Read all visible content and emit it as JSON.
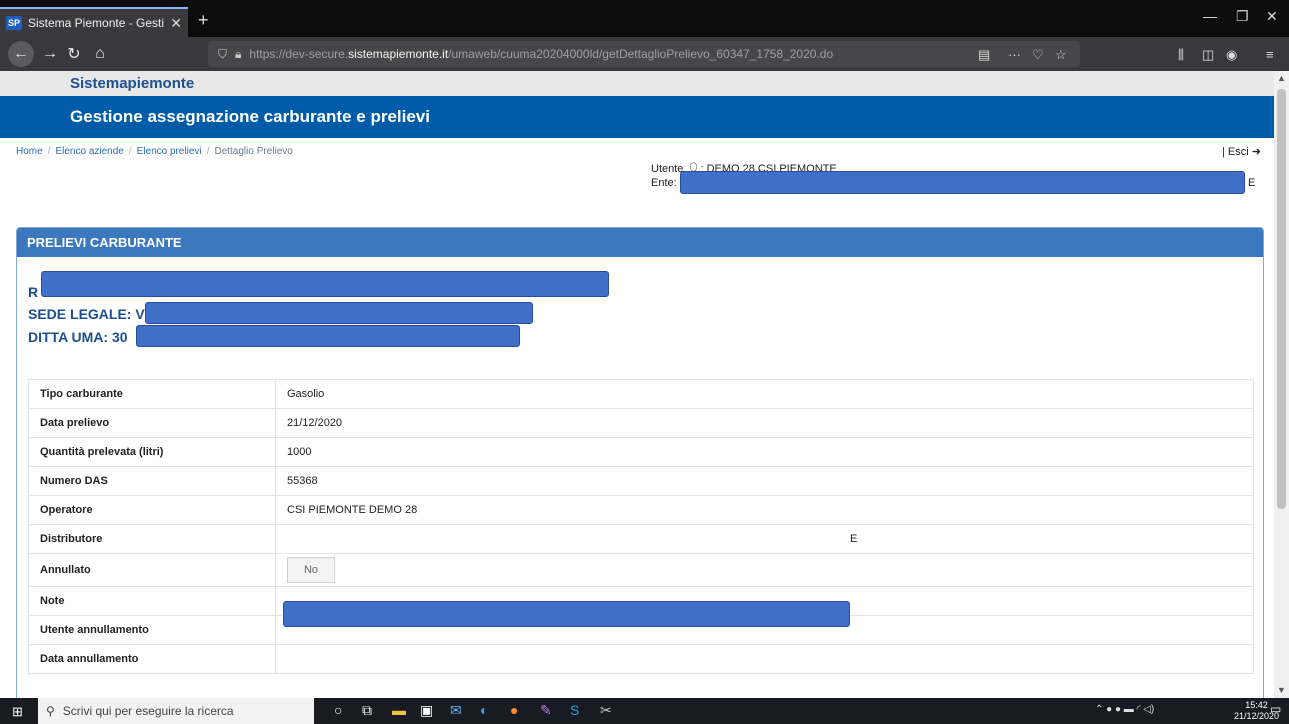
{
  "browser": {
    "tab_favicon": "SP",
    "tab_title": "Sistema Piemonte - Gestione a",
    "url_prefix": "https://dev-secure.",
    "url_domain": "sistemapiemonte.it",
    "url_path": "/umaweb/cuuma20204000ld/getDettaglioPrelievo_60347_1758_2020.do"
  },
  "site": {
    "brand": "Sistemapiemonte",
    "title": "Gestione assegnazione carburante e prelievi"
  },
  "breadcrumb": {
    "home": "Home",
    "aziende": "Elenco aziende",
    "prelievi": "Elenco prelievi",
    "current": "Dettaglio Prelievo"
  },
  "header": {
    "esci": "| Esci",
    "user_label": "Utente",
    "user_value": ": DEMO 28 CSI PIEMONTE",
    "ente_label": "Ente:",
    "ente_tail": "E"
  },
  "panel": {
    "title": "PRELIEVI CARBURANTE",
    "line1": "R",
    "line2": "SEDE LEGALE: V",
    "line3": "DITTA UMA: 30"
  },
  "details": [
    {
      "label": "Tipo carburante",
      "value": "Gasolio"
    },
    {
      "label": "Data prelievo",
      "value": "21/12/2020"
    },
    {
      "label": "Quantità prelevata (litri)",
      "value": "1000"
    },
    {
      "label": "Numero DAS",
      "value": "55368"
    },
    {
      "label": "Operatore",
      "value": "CSI PIEMONTE DEMO 28"
    },
    {
      "label": "Distributore",
      "value": "E"
    },
    {
      "label": "Annullato",
      "value": "No"
    },
    {
      "label": "Note",
      "value": ""
    },
    {
      "label": "Utente annullamento",
      "value": ""
    },
    {
      "label": "Data annullamento",
      "value": ""
    }
  ],
  "taskbar": {
    "search_placeholder": "Scrivi qui per eseguire la ricerca",
    "time": "15:42",
    "date": "21/12/2020"
  }
}
